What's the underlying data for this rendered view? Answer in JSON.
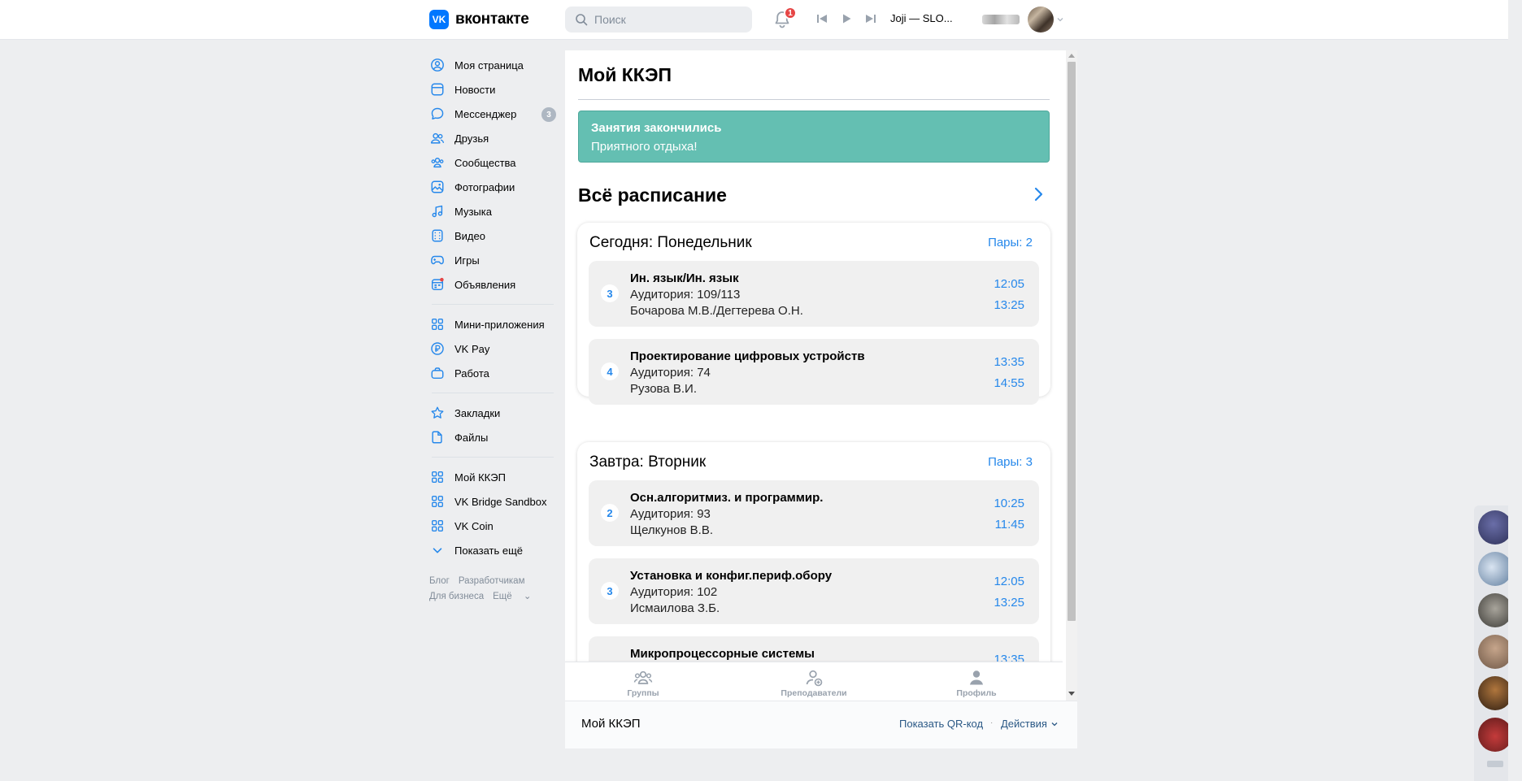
{
  "header": {
    "logo_text": "вконтакте",
    "logo_mark": "VK",
    "search_placeholder": "Поиск",
    "notifications_count": "1",
    "track": "Joji — SLO..."
  },
  "sidebar": {
    "items": [
      {
        "label": "Моя страница",
        "icon": "user-circle-icon"
      },
      {
        "label": "Новости",
        "icon": "news-icon"
      },
      {
        "label": "Мессенджер",
        "icon": "message-icon",
        "count": "3"
      },
      {
        "label": "Друзья",
        "icon": "friends-icon"
      },
      {
        "label": "Сообщества",
        "icon": "communities-icon"
      },
      {
        "label": "Фотографии",
        "icon": "photos-icon"
      },
      {
        "label": "Музыка",
        "icon": "music-icon"
      },
      {
        "label": "Видео",
        "icon": "video-icon"
      },
      {
        "label": "Игры",
        "icon": "gamepad-icon"
      },
      {
        "label": "Объявления",
        "icon": "classifieds-icon"
      }
    ],
    "items2": [
      {
        "label": "Мини-приложения",
        "icon": "apps-icon"
      },
      {
        "label": "VK Pay",
        "icon": "vkpay-icon"
      },
      {
        "label": "Работа",
        "icon": "briefcase-icon"
      }
    ],
    "items3": [
      {
        "label": "Закладки",
        "icon": "star-icon"
      },
      {
        "label": "Файлы",
        "icon": "file-icon"
      }
    ],
    "items4": [
      {
        "label": "Мой ККЭП",
        "icon": "apps-icon"
      },
      {
        "label": "VK Bridge Sandbox",
        "icon": "apps-icon"
      },
      {
        "label": "VK Coin",
        "icon": "apps-icon"
      },
      {
        "label": "Показать ещё",
        "icon": "chevron-down-icon"
      }
    ],
    "footer": {
      "blog": "Блог",
      "developers": "Разработчикам",
      "business": "Для бизнеса",
      "more": "Ещё"
    }
  },
  "app": {
    "title": "Мой ККЭП",
    "notice": {
      "heading": "Занятия закончились",
      "text": "Приятного отдыха!"
    },
    "schedule_heading": "Всё расписание",
    "days": [
      {
        "title": "Сегодня: Понедельник",
        "count": "Пары: 2",
        "lessons": [
          {
            "num": "3",
            "subject": "Ин. язык/Ин. язык",
            "room": "Аудитория: 109/113",
            "teacher": "Бочарова М.В./Дегтерева О.Н.",
            "start": "12:05",
            "end": "13:25"
          },
          {
            "num": "4",
            "subject": "Проектирование цифровых устройств",
            "room": "Аудитория: 74",
            "teacher": "Рузова В.И.",
            "start": "13:35",
            "end": "14:55"
          }
        ]
      },
      {
        "title": "Завтра: Вторник",
        "count": "Пары: 3",
        "lessons": [
          {
            "num": "2",
            "subject": "Осн.алгоритмиз. и программир.",
            "room": "Аудитория: 93",
            "teacher": "Щелкунов В.В.",
            "start": "10:25",
            "end": "11:45"
          },
          {
            "num": "3",
            "subject": "Установка и конфиг.периф.обору",
            "room": "Аудитория: 102",
            "teacher": "Исмаилова З.Б.",
            "start": "12:05",
            "end": "13:25"
          },
          {
            "num": "",
            "subject": "Микропроцессорные системы",
            "room": "",
            "teacher": "",
            "start": "13:35",
            "end": ""
          }
        ]
      }
    ],
    "tabs": [
      {
        "label": "Группы",
        "icon": "groups-icon"
      },
      {
        "label": "Преподаватели",
        "icon": "teachers-icon"
      },
      {
        "label": "Профиль",
        "icon": "profile-icon"
      }
    ],
    "footer": {
      "name": "Мой ККЭП",
      "qr": "Показать QR-код",
      "separator": "·",
      "actions": "Действия"
    }
  },
  "colors": {
    "accent": "#2688eb",
    "notice_bg": "#64bfb2",
    "vk_blue": "#0077ff",
    "badge_red": "#e64646"
  }
}
